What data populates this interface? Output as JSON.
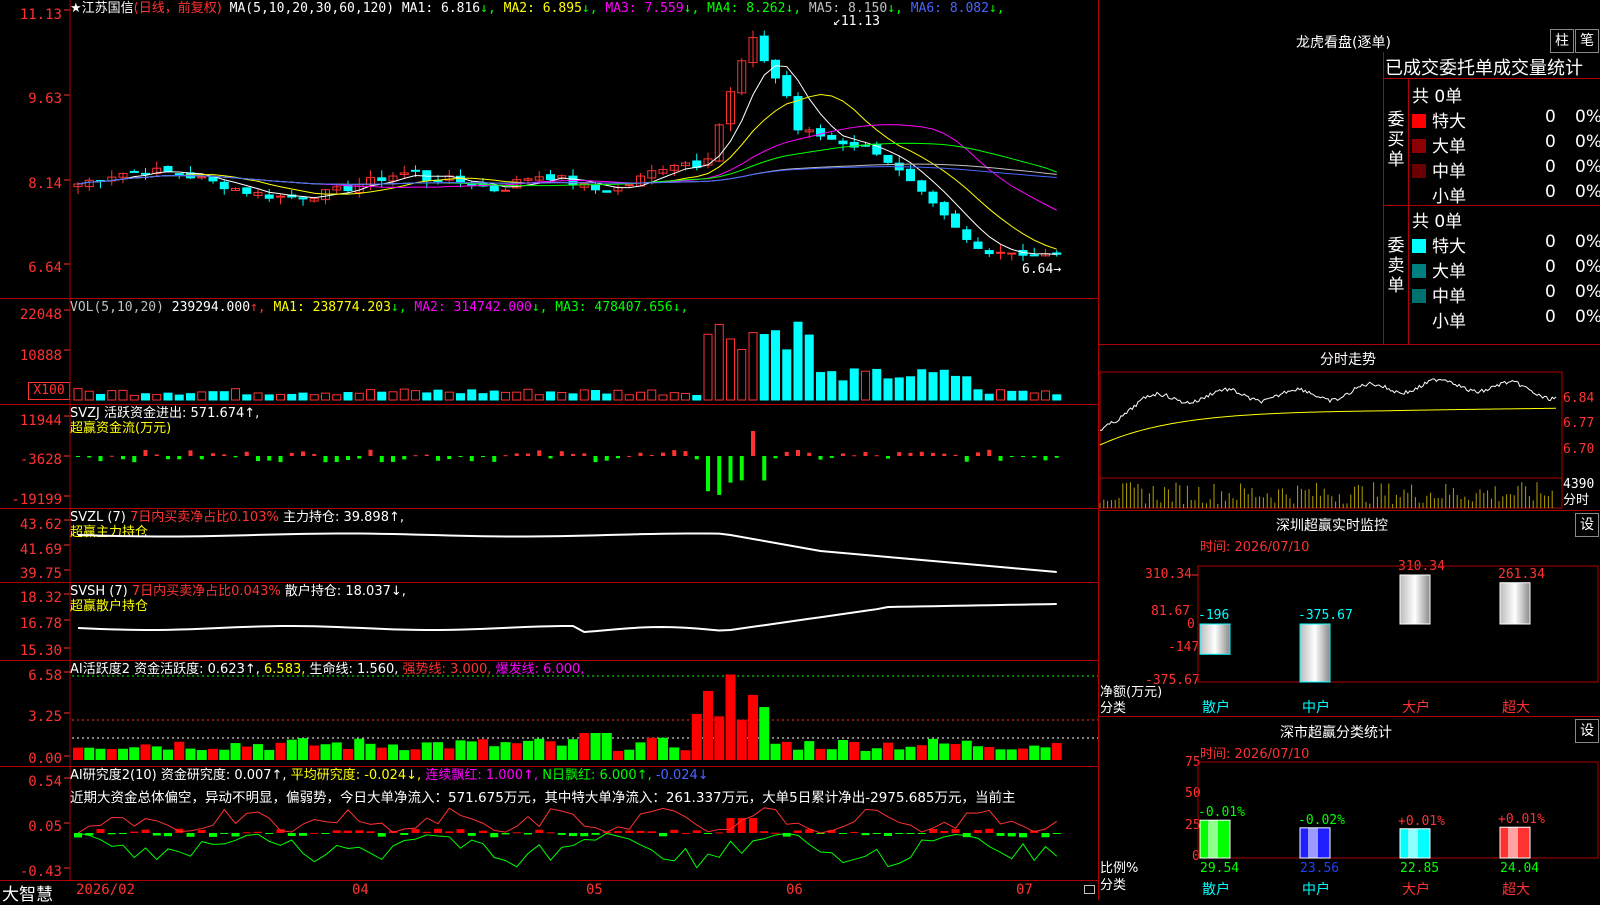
{
  "stock": {
    "name": "江苏国信",
    "mode": "(日线，前复权)",
    "star": "★"
  },
  "main": {
    "ma_label": "MA(5,10,20,30,60,120)",
    "ma_items": [
      {
        "label": "MA1: 6.816",
        "arrow": "↓",
        "color": "#ffffff"
      },
      {
        "label": "MA2: 6.895",
        "arrow": "↓",
        "color": "#ffff00"
      },
      {
        "label": "MA3: 7.559",
        "arrow": "↓",
        "color": "#ff00ff"
      },
      {
        "label": "MA4: 8.262",
        "arrow": "↓",
        "color": "#00ff00"
      },
      {
        "label": "MA5: 8.150",
        "arrow": "↓",
        "color": "#c0c0c0"
      },
      {
        "label": "MA6: 8.082",
        "arrow": "↓",
        "color": "#4a64ff"
      }
    ],
    "axis": [
      "11.13",
      "9.63",
      "8.14",
      "6.64"
    ],
    "high_mark": "11.13",
    "low_mark": "6.64",
    "y_min": 6.2,
    "y_max": 11.4
  },
  "vol": {
    "label": "VOL(5,10,20)",
    "items": [
      {
        "label": "239294.000",
        "arrow": "↑",
        "color": "#ffffff"
      },
      {
        "label": "MA1: 238774.203",
        "arrow": "↓",
        "color": "#ffff00"
      },
      {
        "label": "MA2: 314742.000",
        "arrow": "↓",
        "color": "#ff00ff"
      },
      {
        "label": "MA3: 478407.656",
        "arrow": "↓",
        "color": "#00ff00"
      }
    ],
    "axis": [
      "22048",
      "10888",
      "X100"
    ]
  },
  "svzj": {
    "title": "SVZJ  活跃资金进出: 571.674↑,",
    "subtitle": "超赢资金流(万元)",
    "axis": [
      "11944",
      "-3628",
      "-19199"
    ]
  },
  "svzl": {
    "title_a": "SVZL (7)",
    "title_b": "7日内买卖净占比0.103%",
    "title_c": "主力持仓: 39.898↑,",
    "subtitle": "超赢主力持仓",
    "axis": [
      "43.62",
      "41.69",
      "39.75"
    ]
  },
  "svsh": {
    "title_a": "SVSH (7)",
    "title_b": "7日内买卖净占比0.043%",
    "title_c": "散户持仓: 18.037↓,",
    "subtitle": "超赢散户持仓",
    "axis": [
      "18.32",
      "16.78",
      "15.30"
    ]
  },
  "ai1": {
    "title_a": "AI活跃度2 资金活跃度: 0.623↑,",
    "title_b": "6.583,",
    "title_c": "生命线: 1.560,",
    "title_d": "强势线: 3.000,",
    "title_e": "爆发线: 6.000,",
    "axis": [
      "6.58",
      "3.25",
      "0.00"
    ]
  },
  "ai2": {
    "title_a": "AI研究度2(10) 资金研究度: 0.007↑,",
    "title_b": "平均研究度: -0.024↓,",
    "title_c": "连续飘红: 1.000↑,",
    "title_d": "N日飘红: 6.000↑,",
    "title_e": "-0.024↓",
    "summary": "近期大资金总体偏空，异动不明显，偏弱势，今日大单净流入：571.675万元，其中特大单净流入：261.337万元，大单5日累计净出-2975.685万元，当前主",
    "axis": [
      "0.54",
      "0.05",
      "-0.43"
    ]
  },
  "xaxis": {
    "brand": "大智慧",
    "labels": [
      "2026/02",
      "04",
      "05",
      "06",
      "07"
    ]
  },
  "right": {
    "lhb_title": "龙虎看盘(逐单)",
    "btn_zhu": "柱",
    "btn_bi": "笔",
    "stats_title": "已成交委托单成交量统计",
    "buy_label": "委买单",
    "sell_label": "委卖单",
    "buy_total": "共 0单",
    "sell_total": "共 0单",
    "buy_rows": [
      {
        "name": "特大",
        "count": "0",
        "pct": "0%",
        "color": "#ff0000"
      },
      {
        "name": "大单",
        "count": "0",
        "pct": "0%",
        "color": "#8b0000"
      },
      {
        "name": "中单",
        "count": "0",
        "pct": "0%",
        "color": "#6b0000"
      },
      {
        "name": "小单",
        "count": "0",
        "pct": "0%",
        "color": ""
      }
    ],
    "sell_rows": [
      {
        "name": "特大",
        "count": "0",
        "pct": "0%",
        "color": "#00ffff"
      },
      {
        "name": "大单",
        "count": "0",
        "pct": "0%",
        "color": "#008080"
      },
      {
        "name": "中单",
        "count": "0",
        "pct": "0%",
        "color": "#007070"
      },
      {
        "name": "小单",
        "count": "0",
        "pct": "0%",
        "color": ""
      }
    ],
    "intraday_title": "分时走势",
    "intraday_axis": [
      "6.84",
      "6.77",
      "6.70",
      "4390",
      "分时"
    ],
    "monitor_title": "深圳超赢实时监控",
    "monitor_btn": "设",
    "monitor_time": "时间: 2026/07/10",
    "monitor_axis": [
      "310.34",
      "81.67",
      "0",
      "-147",
      "-375.67"
    ],
    "monitor_ylabel": "净额(万元)",
    "monitor_xlabel": "分类",
    "monitor_bars": [
      {
        "cat": "散户",
        "value": -196,
        "label": "-196",
        "color": "#00ffff"
      },
      {
        "cat": "中户",
        "value": -375.67,
        "label": "-375.67",
        "color": "#00ffff"
      },
      {
        "cat": "大户",
        "value": 310.34,
        "label": "310.34",
        "color": "#ff3232"
      },
      {
        "cat": "超大",
        "value": 261.34,
        "label": "261.34",
        "color": "#ff3232"
      }
    ],
    "classify_title": "深市超赢分类统计",
    "classify_btn": "设",
    "classify_time": "时间: 2026/07/10",
    "classify_axis": [
      "75",
      "50",
      "25",
      "0"
    ],
    "classify_ylabel": "比例%",
    "classify_xlabel": "分类",
    "classify_bars": [
      {
        "cat": "散户",
        "value": 29.54,
        "label": "29.54",
        "top": "-0.01%",
        "topcolor": "#00ff00",
        "color": "#00ff00"
      },
      {
        "cat": "中户",
        "value": 23.56,
        "label": "23.56",
        "top": "-0.02%",
        "topcolor": "#00ff00",
        "color": "#2020ff"
      },
      {
        "cat": "大户",
        "value": 22.85,
        "label": "22.85",
        "top": "+0.01%",
        "topcolor": "#ff3232",
        "color": "#00ffff"
      },
      {
        "cat": "超大",
        "value": 24.04,
        "label": "24.04",
        "top": "+0.01%",
        "topcolor": "#ff3232",
        "color": "#ff3232"
      }
    ]
  }
}
